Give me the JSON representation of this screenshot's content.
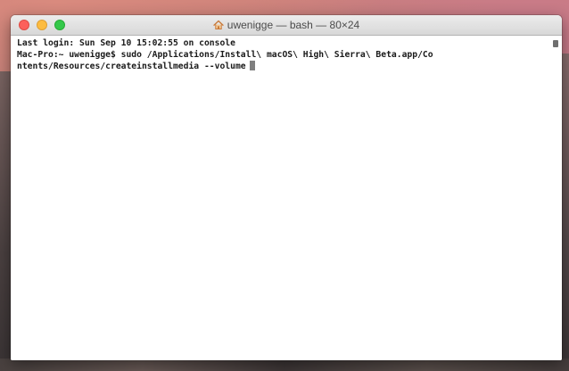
{
  "window": {
    "title": "uwenigge — bash — 80×24",
    "title_icon": "home-icon"
  },
  "traffic_lights": {
    "close_color": "#fc605b",
    "minimize_color": "#fdbc40",
    "zoom_color": "#34c84a"
  },
  "terminal": {
    "lines": [
      "Last login: Sun Sep 10 15:02:55 on console",
      "Mac-Pro:~ uwenigge$ sudo /Applications/Install\\ macOS\\ High\\ Sierra\\ Beta.app/Co",
      "ntents/Resources/createinstallmedia --volume"
    ],
    "cursor_color": "#7f7f7f"
  }
}
